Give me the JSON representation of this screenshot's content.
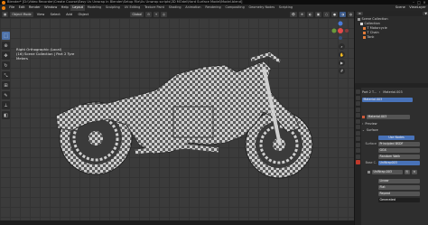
{
  "window": {
    "title": "Blender* [D:\\Video Recorder\\Create Course\\Easy Uv Unwrap in Blender\\Setup File\\Uv Unwrap scripts\\3D MOdel\\Hard Surface Model\\Model.blend]"
  },
  "menu": [
    "File",
    "Edit",
    "Render",
    "Window",
    "Help"
  ],
  "workspaces": [
    "Layout",
    "Modeling",
    "Sculpting",
    "UV Editing",
    "Texture Paint",
    "Shading",
    "Animation",
    "Rendering",
    "Compositing",
    "Geometry Nodes",
    "Scripting"
  ],
  "active_workspace": "Layout",
  "scene": {
    "label": "Scene",
    "viewlayer": "ViewLayer"
  },
  "viewport_header": {
    "mode": "Object Mode",
    "view": "View",
    "select": "Select",
    "add": "Add",
    "object": "Object",
    "transform": "Global"
  },
  "overlay": {
    "line1": "Right Orthographic (Local)",
    "line2": "(16) Scene Collection | Part 2 Tyre",
    "line3": "Meters"
  },
  "outliner": {
    "title": "Scene Collection",
    "rows": [
      {
        "label": "Collection",
        "color": "#d9d9d9"
      },
      {
        "label": "T Motorcycle",
        "color": "#e07b39"
      },
      {
        "label": "T Chain",
        "color": "#e07b39"
      },
      {
        "label": "Tank",
        "color": "#e07b39"
      }
    ]
  },
  "properties": {
    "breadcrumb_obj": "Part 2 T...",
    "breadcrumb_mat": "Material.003",
    "slot": "Material.003",
    "material_name": "Material.003",
    "preview": "Preview",
    "surface": "Surface",
    "use_nodes": "Use Nodes",
    "surface_label": "Surface",
    "surface_value": "Principled BSDF",
    "dist": "GGX",
    "sss": "Random Walk",
    "base_color_label": "Base C.",
    "base_color_value": "UnWrap003",
    "image_name": "UnWrap.003",
    "linear": "Linear",
    "flat": "Flat",
    "repeat": "Repeat",
    "generated": "Generated"
  },
  "colors": {
    "accent": "#4872b8",
    "blender_orange": "#e87d0d"
  }
}
